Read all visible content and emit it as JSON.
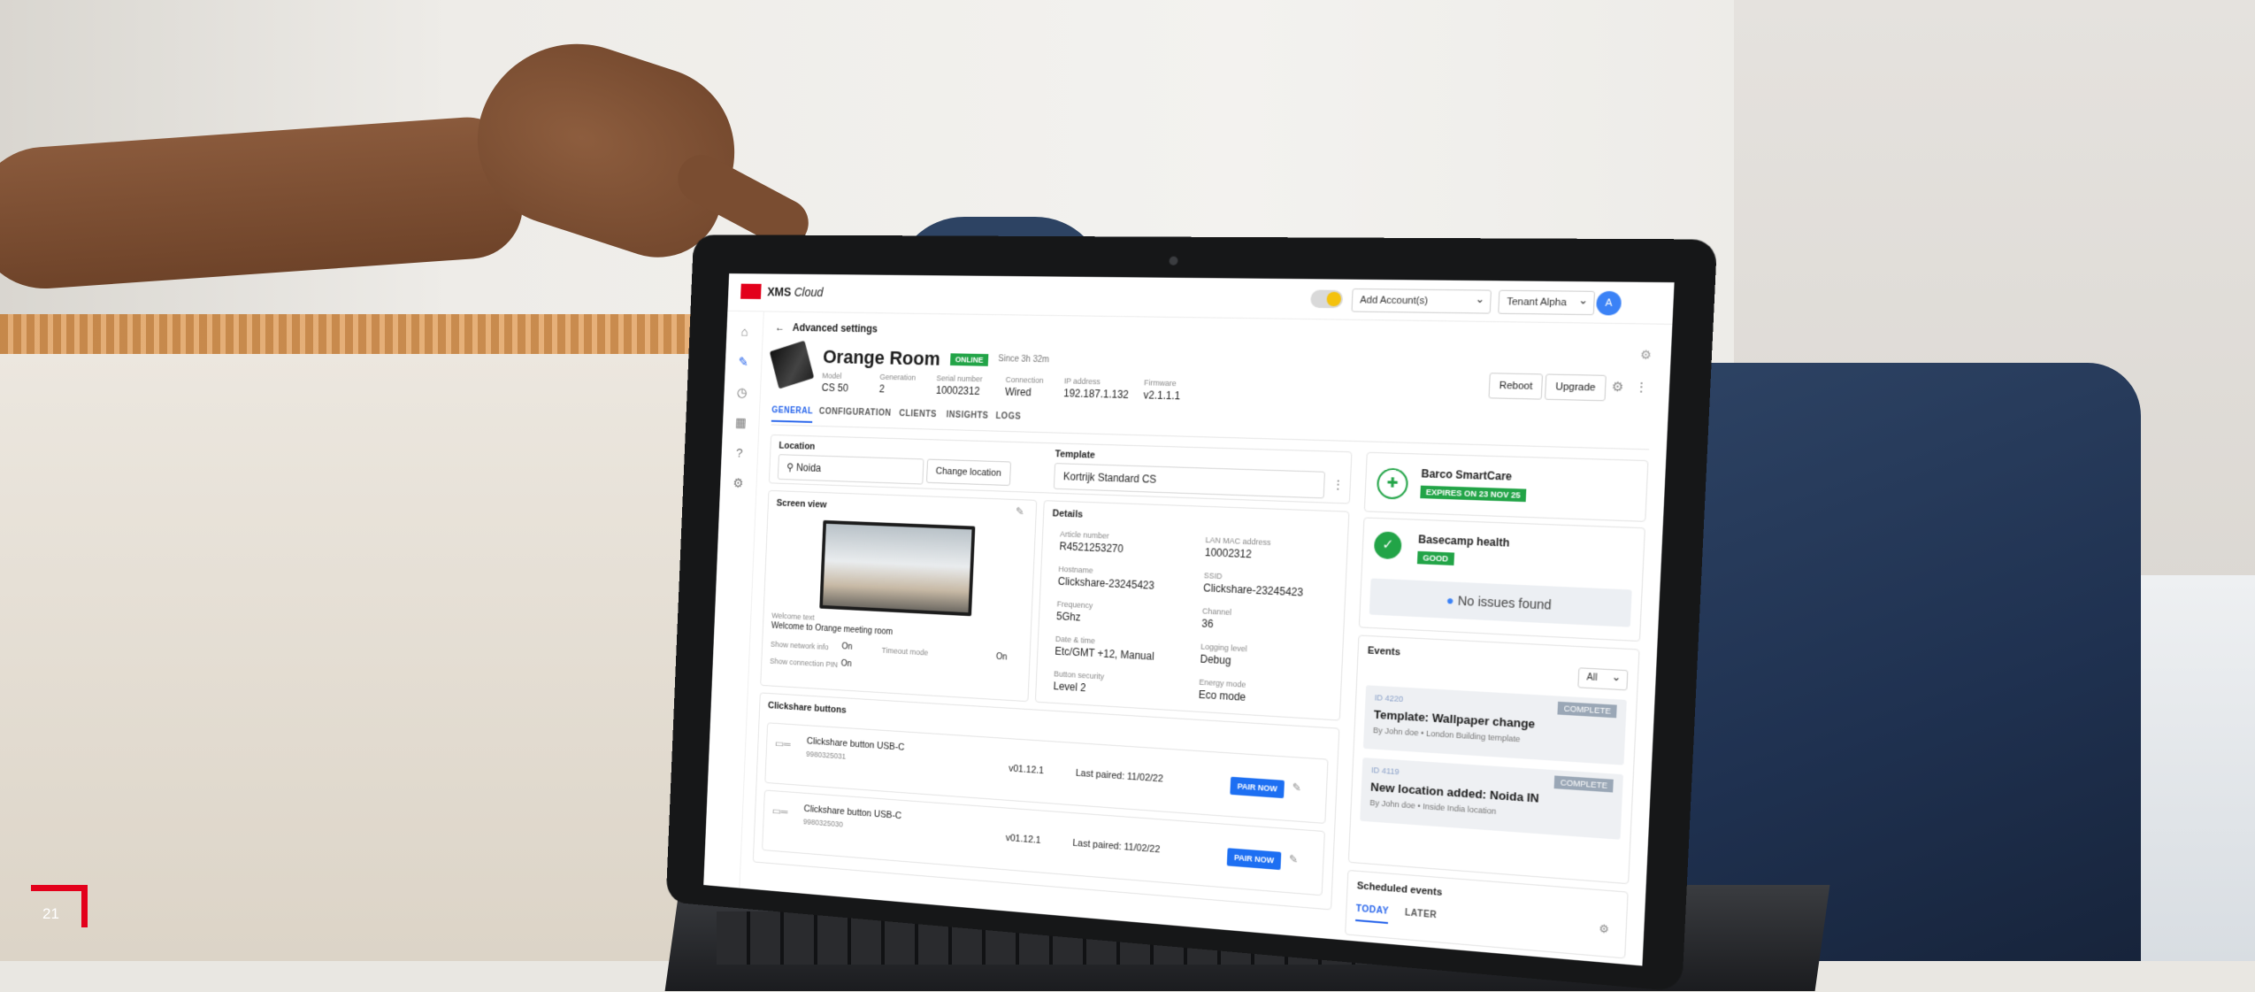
{
  "app": {
    "brand": "XMS",
    "brand_suffix": "Cloud"
  },
  "topbar": {
    "account_select": "Add Account(s)",
    "tenant_select": "Tenant Alpha",
    "avatar": "A"
  },
  "nav": {
    "back_label": "Advanced settings"
  },
  "device": {
    "name": "Orange Room",
    "status": "ONLINE",
    "since": "Since 3h 32m",
    "meta": [
      {
        "key": "Model",
        "value": "CS 50"
      },
      {
        "key": "Generation",
        "value": "2"
      },
      {
        "key": "Serial number",
        "value": "10002312"
      },
      {
        "key": "Connection",
        "value": "Wired"
      },
      {
        "key": "IP address",
        "value": "192.187.1.132"
      },
      {
        "key": "Firmware",
        "value": "v2.1.1.1"
      }
    ],
    "reboot_label": "Reboot",
    "upgrade_label": "Upgrade"
  },
  "tabs": [
    "GENERAL",
    "CONFIGURATION",
    "CLIENTS",
    "INSIGHTS",
    "LOGS"
  ],
  "location": {
    "label": "Location",
    "value": "Noida",
    "change_label": "Change location"
  },
  "template": {
    "label": "Template",
    "value": "Kortrijk Standard CS"
  },
  "smartcare": {
    "title": "Barco SmartCare",
    "status": "EXPIRES ON 23 NOV 25"
  },
  "health": {
    "title": "Basecamp health",
    "status": "GOOD",
    "message": "No issues found"
  },
  "screen_view": {
    "title": "Screen view",
    "welcome_label": "Welcome text",
    "welcome_value": "Welcome to Orange meeting room",
    "row1_key": "Show network info",
    "row1_value": "On",
    "row2_key": "Show connection PIN",
    "row2_value": "On",
    "row3_key": "Timeout mode",
    "row3_value": "On"
  },
  "details": {
    "title": "Details",
    "items": [
      {
        "key": "Article number",
        "value": "R4521253270"
      },
      {
        "key": "LAN MAC address",
        "value": "10002312"
      },
      {
        "key": "Hostname",
        "value": "Clickshare-23245423"
      },
      {
        "key": "SSID",
        "value": "Clickshare-23245423"
      },
      {
        "key": "Frequency",
        "value": "5Ghz"
      },
      {
        "key": "Channel",
        "value": "36"
      },
      {
        "key": "Date & time",
        "value": "Etc/GMT +12, Manual"
      },
      {
        "key": "Logging level",
        "value": "Debug"
      },
      {
        "key": "Button security",
        "value": "Level 2"
      },
      {
        "key": "Energy mode",
        "value": "Eco mode"
      }
    ]
  },
  "buttons": {
    "title": "Clickshare buttons",
    "items": [
      {
        "name": "Clickshare button USB-C",
        "serial": "9980325031",
        "version": "v01.12.1",
        "paired": "Last paired: 11/02/22",
        "action": "PAIR NOW"
      },
      {
        "name": "Clickshare button USB-C",
        "serial": "9980325030",
        "version": "v01.12.1",
        "paired": "Last paired: 11/02/22",
        "action": "PAIR NOW"
      }
    ]
  },
  "events": {
    "title": "Events",
    "filter": "All",
    "items": [
      {
        "id": "ID 4220",
        "status": "COMPLETE",
        "title": "Template: Wallpaper change",
        "sub": "By John doe • London Building template"
      },
      {
        "id": "ID 4119",
        "status": "COMPLETE",
        "title": "New location added: Noida IN",
        "sub": "By John doe • Inside India location"
      }
    ]
  },
  "scheduled": {
    "title": "Scheduled events",
    "tabs": [
      "TODAY",
      "LATER"
    ]
  },
  "page_number": "21",
  "colors": {
    "brand_red": "#e3001b",
    "accent_blue": "#1d6ff2",
    "status_green": "#22a447"
  }
}
